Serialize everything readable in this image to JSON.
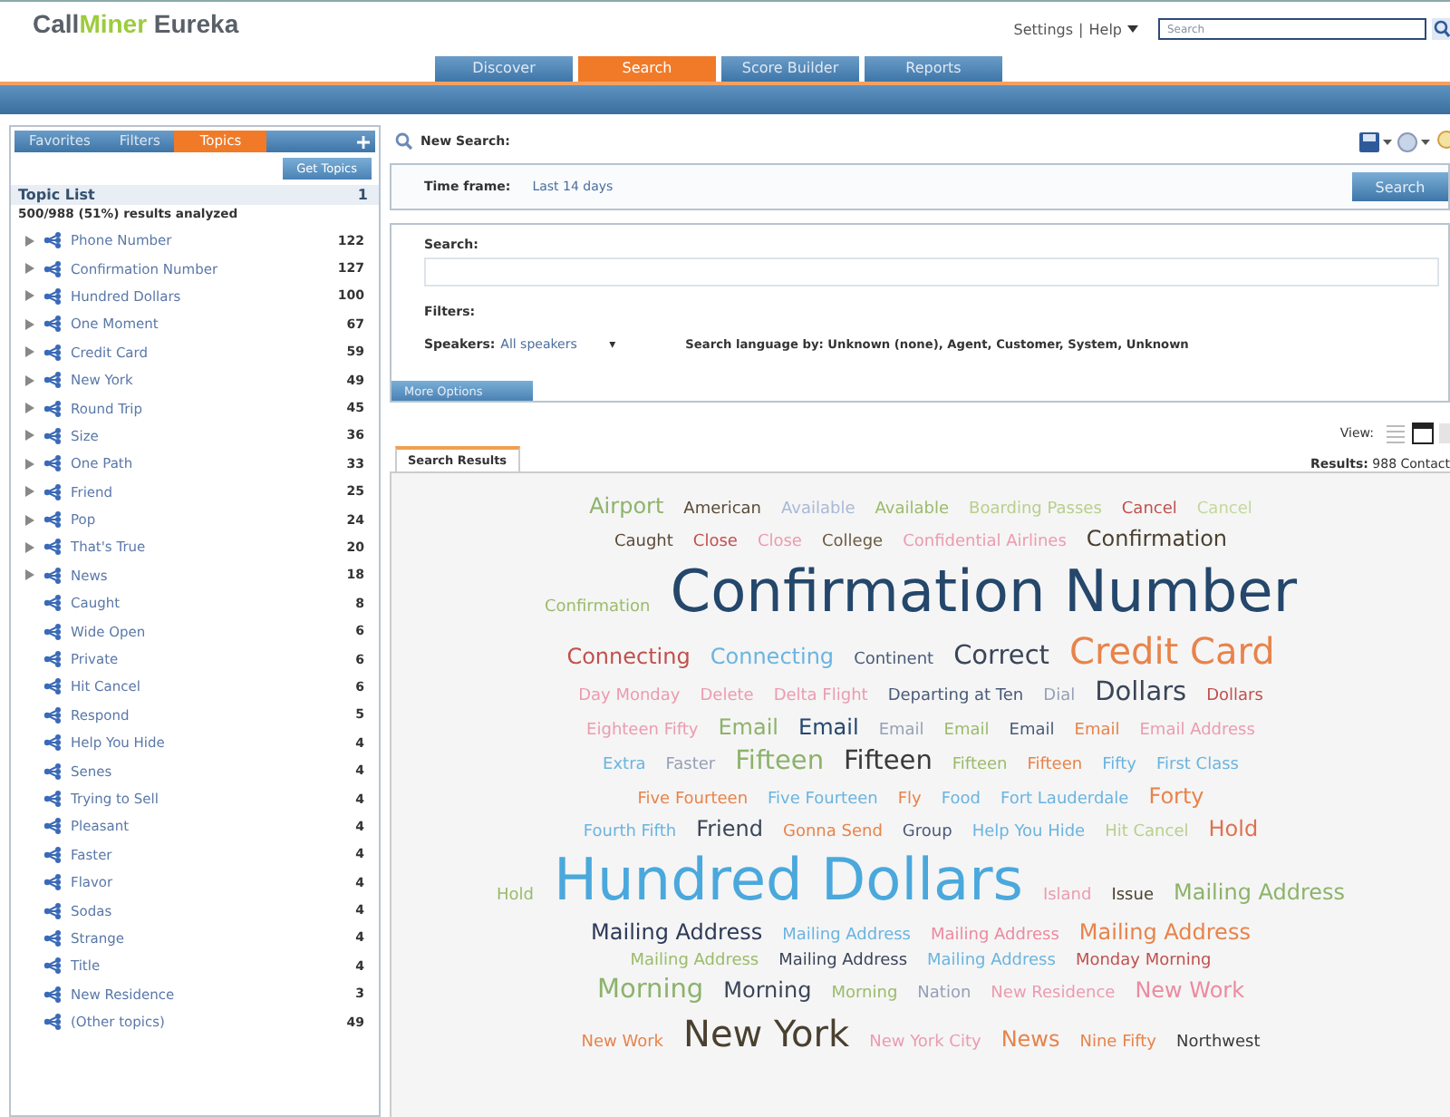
{
  "header": {
    "logo_first": "Call",
    "logo_mid": "Miner",
    "logo_last": "Eureka",
    "links": [
      {
        "label": "Settings"
      },
      {
        "label": "Help"
      }
    ],
    "separator": "|",
    "search": {
      "placeholder": "Search"
    }
  },
  "nav_tabs": [
    {
      "label": "Discover",
      "selected": false
    },
    {
      "label": "Search",
      "selected": true
    },
    {
      "label": "Score Builder",
      "selected": false
    },
    {
      "label": "Reports",
      "selected": false
    }
  ],
  "sidebar": {
    "tabs": [
      {
        "label": "Favorites",
        "selected": false
      },
      {
        "label": "Filters",
        "selected": false
      },
      {
        "label": "Topics",
        "selected": true
      }
    ],
    "button": "Get Topics",
    "list_title": "Topic List",
    "list_title_count": "1",
    "summary": "500/988 (51%) results analyzed",
    "topics": [
      {
        "label": "Phone Number",
        "count": "122",
        "kind": "group"
      },
      {
        "label": "Confirmation Number",
        "count": "127",
        "kind": "group"
      },
      {
        "label": "Hundred Dollars",
        "count": "100",
        "kind": "group"
      },
      {
        "label": "One Moment",
        "count": "67",
        "kind": "group"
      },
      {
        "label": "Credit Card",
        "count": "59",
        "kind": "group"
      },
      {
        "label": "New York",
        "count": "49",
        "kind": "group"
      },
      {
        "label": "Round Trip",
        "count": "45",
        "kind": "group"
      },
      {
        "label": "Size",
        "count": "36",
        "kind": "group"
      },
      {
        "label": "One Path",
        "count": "33",
        "kind": "group"
      },
      {
        "label": "Friend",
        "count": "25",
        "kind": "group"
      },
      {
        "label": "Pop",
        "count": "24",
        "kind": "group"
      },
      {
        "label": "That's True",
        "count": "20",
        "kind": "group"
      },
      {
        "label": "News",
        "count": "18",
        "kind": "group"
      },
      {
        "label": "Caught",
        "count": "8",
        "kind": "leaf"
      },
      {
        "label": "Wide Open",
        "count": "6",
        "kind": "leaf"
      },
      {
        "label": "Private",
        "count": "6",
        "kind": "leaf"
      },
      {
        "label": "Hit Cancel",
        "count": "6",
        "kind": "leaf"
      },
      {
        "label": "Respond",
        "count": "5",
        "kind": "leaf"
      },
      {
        "label": "Help You Hide",
        "count": "4",
        "kind": "leaf"
      },
      {
        "label": "Senes",
        "count": "4",
        "kind": "leaf"
      },
      {
        "label": "Trying to Sell",
        "count": "4",
        "kind": "leaf"
      },
      {
        "label": "Pleasant",
        "count": "4",
        "kind": "leaf"
      },
      {
        "label": "Faster",
        "count": "4",
        "kind": "leaf"
      },
      {
        "label": "Flavor",
        "count": "4",
        "kind": "leaf"
      },
      {
        "label": "Sodas",
        "count": "4",
        "kind": "leaf"
      },
      {
        "label": "Strange",
        "count": "4",
        "kind": "leaf"
      },
      {
        "label": "Title",
        "count": "4",
        "kind": "leaf"
      },
      {
        "label": "New Residence",
        "count": "3",
        "kind": "leaf"
      },
      {
        "label": "(Other topics)",
        "count": "49",
        "kind": "leaf"
      }
    ]
  },
  "main": {
    "title": "New Search:",
    "time_frame_label": "Time frame:",
    "time_frame_value": "Last 14 days",
    "search_button": "Search",
    "search_label": "Search:",
    "filters_label": "Filters:",
    "speakers_label": "Speakers:",
    "speakers_value": "All speakers",
    "speakers_caret": "▾",
    "language": "Search language by: Unknown (none), Agent, Customer, System, Unknown",
    "more_options": "More Options",
    "view_label": "View:",
    "results_tab": "Search Results",
    "results_label": "Results:",
    "results_value": "988 Contact",
    "cloud": [
      [
        {
          "text": "Airport",
          "color": "#8db36b",
          "kind": "m"
        },
        {
          "text": "American",
          "color": "#5a4a38",
          "kind": "s"
        },
        {
          "text": "Available",
          "color": "#a9b8d8",
          "kind": "s"
        },
        {
          "text": "Available",
          "color": "#9bbb6a",
          "kind": "s"
        },
        {
          "text": "Boarding Passes",
          "color": "#b8cf8c",
          "kind": "s"
        },
        {
          "text": "Cancel",
          "color": "#c0504d",
          "kind": "s"
        },
        {
          "text": "Cancel",
          "color": "#c3d79b",
          "kind": "s"
        }
      ],
      [
        {
          "text": "Caught",
          "color": "#5a4a38",
          "kind": "s"
        },
        {
          "text": "Close",
          "color": "#c0504d",
          "kind": "s"
        },
        {
          "text": "Close",
          "color": "#ec9bb0",
          "kind": "s"
        },
        {
          "text": "College",
          "color": "#6a5a40",
          "kind": "s"
        },
        {
          "text": "Confidential Airlines",
          "color": "#ec9bb0",
          "kind": "s"
        },
        {
          "text": "Confirmation",
          "color": "#4a4030",
          "kind": "m"
        }
      ],
      [
        {
          "text": "Confirmation",
          "color": "#9bbb6a",
          "kind": "s"
        },
        {
          "text": "Confirmation Number",
          "color": "#24476b",
          "kind": "xxl"
        }
      ],
      [
        {
          "text": "Connecting",
          "color": "#c0504d",
          "kind": "m"
        },
        {
          "text": "Connecting",
          "color": "#6ab4e0",
          "kind": "m"
        },
        {
          "text": "Continent",
          "color": "#4a5a78",
          "kind": "s"
        },
        {
          "text": "Correct",
          "color": "#3a4558",
          "kind": "l"
        },
        {
          "text": "Credit Card",
          "color": "#e8834a",
          "kind": "xl"
        }
      ],
      [
        {
          "text": "Day Monday",
          "color": "#ec9bb0",
          "kind": "s"
        },
        {
          "text": "Delete",
          "color": "#ec9bb0",
          "kind": "s"
        },
        {
          "text": "Delta Flight",
          "color": "#ec9bb0",
          "kind": "s"
        },
        {
          "text": "Departing at Ten",
          "color": "#4a5a78",
          "kind": "s"
        },
        {
          "text": "Dial",
          "color": "#96a0b6",
          "kind": "s"
        },
        {
          "text": "Dollars",
          "color": "#3a4558",
          "kind": "l"
        },
        {
          "text": "Dollars",
          "color": "#c0504d",
          "kind": "s"
        }
      ],
      [
        {
          "text": "Eighteen Fifty",
          "color": "#ec9bb0",
          "kind": "s"
        },
        {
          "text": "Email",
          "color": "#8db36b",
          "kind": "m"
        },
        {
          "text": "Email",
          "color": "#24476b",
          "kind": "m"
        },
        {
          "text": "Email",
          "color": "#96a0b6",
          "kind": "s"
        },
        {
          "text": "Email",
          "color": "#9bbb6a",
          "kind": "s"
        },
        {
          "text": "Email",
          "color": "#4a5a78",
          "kind": "s"
        },
        {
          "text": "Email",
          "color": "#e8834a",
          "kind": "s"
        },
        {
          "text": "Email Address",
          "color": "#ec9bb0",
          "kind": "s"
        }
      ],
      [
        {
          "text": "Extra",
          "color": "#6ab4e0",
          "kind": "s"
        },
        {
          "text": "Faster",
          "color": "#96a0b6",
          "kind": "s"
        },
        {
          "text": "Fifteen",
          "color": "#8db36b",
          "kind": "l"
        },
        {
          "text": "Fifteen",
          "color": "#3a3a3a",
          "kind": "l"
        },
        {
          "text": "Fifteen",
          "color": "#9bbb6a",
          "kind": "s"
        },
        {
          "text": "Fifteen",
          "color": "#e8834a",
          "kind": "s"
        },
        {
          "text": "Fifty",
          "color": "#6ab4e0",
          "kind": "s"
        },
        {
          "text": "First Class",
          "color": "#6ab4e0",
          "kind": "s"
        }
      ],
      [
        {
          "text": "Five Fourteen",
          "color": "#e8834a",
          "kind": "s"
        },
        {
          "text": "Five Fourteen",
          "color": "#6ab4e0",
          "kind": "s"
        },
        {
          "text": "Fly",
          "color": "#e8834a",
          "kind": "s"
        },
        {
          "text": "Food",
          "color": "#6ab4e0",
          "kind": "s"
        },
        {
          "text": "Fort Lauderdale",
          "color": "#6ab4e0",
          "kind": "s"
        },
        {
          "text": "Forty",
          "color": "#e8834a",
          "kind": "m"
        }
      ],
      [
        {
          "text": "Fourth Fifth",
          "color": "#6ab4e0",
          "kind": "s"
        },
        {
          "text": "Friend",
          "color": "#3a4558",
          "kind": "m"
        },
        {
          "text": "Gonna Send",
          "color": "#e8834a",
          "kind": "s"
        },
        {
          "text": "Group",
          "color": "#4a5a78",
          "kind": "s"
        },
        {
          "text": "Help You Hide",
          "color": "#6ab4e0",
          "kind": "s"
        },
        {
          "text": "Hit Cancel",
          "color": "#b8cf8c",
          "kind": "s"
        },
        {
          "text": "Hold",
          "color": "#e07050",
          "kind": "m"
        }
      ],
      [
        {
          "text": "Hold",
          "color": "#9bbb6a",
          "kind": "s"
        },
        {
          "text": "Hundred Dollars",
          "color": "#4aa8dc",
          "kind": "xxl"
        },
        {
          "text": "Island",
          "color": "#ec9bb0",
          "kind": "s"
        },
        {
          "text": "Issue",
          "color": "#4a4030",
          "kind": "s"
        },
        {
          "text": "Mailing Address",
          "color": "#8db36b",
          "kind": "m"
        }
      ],
      [
        {
          "text": "Mailing Address",
          "color": "#2e3a58",
          "kind": "m"
        },
        {
          "text": "Mailing Address",
          "color": "#6ab4e0",
          "kind": "s"
        },
        {
          "text": "Mailing Address",
          "color": "#ec8aa0",
          "kind": "s"
        },
        {
          "text": "Mailing Address",
          "color": "#e8834a",
          "kind": "m"
        }
      ],
      [
        {
          "text": "Mailing Address",
          "color": "#9bbb6a",
          "kind": "s"
        },
        {
          "text": "Mailing Address",
          "color": "#3a4558",
          "kind": "s"
        },
        {
          "text": "Mailing Address",
          "color": "#6ab4e0",
          "kind": "s"
        },
        {
          "text": "Monday Morning",
          "color": "#c0504d",
          "kind": "s"
        }
      ],
      [
        {
          "text": "Morning",
          "color": "#8db36b",
          "kind": "l"
        },
        {
          "text": "Morning",
          "color": "#3a4558",
          "kind": "m"
        },
        {
          "text": "Morning",
          "color": "#9bbb6a",
          "kind": "s"
        },
        {
          "text": "Nation",
          "color": "#96a0b6",
          "kind": "s"
        },
        {
          "text": "New Residence",
          "color": "#ec9bb0",
          "kind": "s"
        },
        {
          "text": "New Work",
          "color": "#ec8aa0",
          "kind": "m"
        }
      ],
      [
        {
          "text": "New Work",
          "color": "#e8834a",
          "kind": "s"
        },
        {
          "text": "New York",
          "color": "#4a4030",
          "kind": "xl"
        },
        {
          "text": "New York City",
          "color": "#ec9bb0",
          "kind": "s"
        },
        {
          "text": "News",
          "color": "#e8834a",
          "kind": "m"
        },
        {
          "text": "Nine Fifty",
          "color": "#e8834a",
          "kind": "s"
        },
        {
          "text": "Northwest",
          "color": "#3a3a3a",
          "kind": "s"
        }
      ]
    ]
  }
}
